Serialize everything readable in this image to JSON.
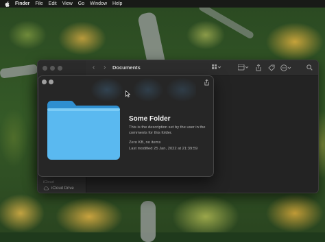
{
  "menubar": {
    "items": [
      "Finder",
      "File",
      "Edit",
      "View",
      "Go",
      "Window",
      "Help"
    ]
  },
  "finder": {
    "title": "Documents",
    "sidebar_section": "iCloud",
    "sidebar_item": "iCloud Drive"
  },
  "info_panel": {
    "name": "Some Folder",
    "description": "This is the description set by the user in the comments for this folder.",
    "size": "Zero KB, no items",
    "modified": "Last modified 25 Jan, 2022 at 21:39:59"
  },
  "icons": [
    "apple-icon",
    "back-chevron-icon",
    "forward-chevron-icon",
    "grid-view-icon",
    "group-icon",
    "share-icon",
    "tag-icon",
    "more-icon",
    "search-icon",
    "close-icon",
    "minimize-icon",
    "folder-icon",
    "cloud-icon",
    "pointer-cursor-icon"
  ],
  "colors": {
    "folder": "#5ab9f0",
    "panel_bg": "#262626",
    "menubar_bg": "#181a17"
  }
}
